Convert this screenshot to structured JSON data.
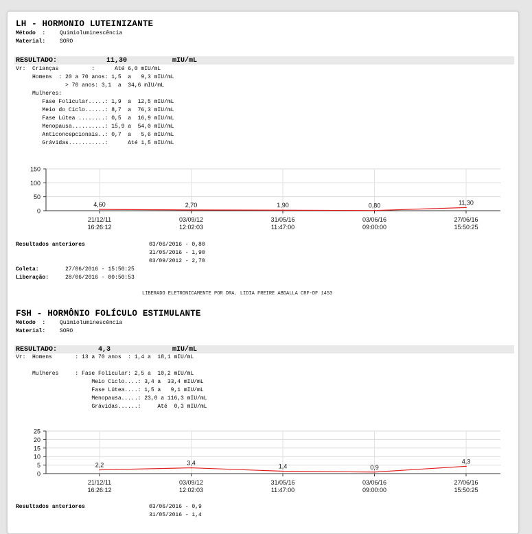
{
  "lh": {
    "title": "LH - HORMONIO LUTEINIZANTE",
    "metodo_label": "Método  :",
    "metodo": "Quimioluminescência",
    "material_label": "Material:",
    "material": "SORO",
    "resultado_label": "RESULTADO:",
    "resultado_value": "11,30",
    "resultado_unit": "mIU/mL",
    "ref_lines": [
      "Vr:  Crianças          :      Até 6,0 mIU/mL",
      "     Homens  : 20 a 70 anos: 1,5  a   9,3 mIU/mL",
      "               > 70 anos: 3,1  a  34,6 mIU/mL",
      "     Mulheres:",
      "        Fase Folicular.....: 1,9  a  12,5 mIU/mL",
      "        Meio do Ciclo......: 8,7  a  76,3 mIU/mL",
      "        Fase Lútea ........: 0,5  a  16,9 mIU/mL",
      "        Menopausa..........: 15,9 a  54,0 mIU/mL",
      "        Anticoncepcionais..: 0,7  a   5,6 mIU/mL",
      "        Grávidas...........:      Até 1,5 mIU/mL"
    ],
    "anteriores_label": "Resultados anteriores",
    "anteriores": [
      "03/06/2016 - 0,80",
      "31/05/2016 - 1,90",
      "03/09/2012 - 2,70"
    ],
    "coleta_label": "Coleta:",
    "coleta": "27/06/2016 - 15:50:25",
    "liberacao_label": "Liberação:",
    "liberacao": "28/06/2016 - 00:50:53",
    "liberado": "LIBERADO ELETRONICAMENTE POR DRA. LIDIA FREIRE ABDALLA CRF-DF 1453"
  },
  "fsh": {
    "title": "FSH - HORMÔNIO FOLÍCULO ESTIMULANTE",
    "metodo_label": "Método  :",
    "metodo": "Quimioluminescência",
    "material_label": "Material:",
    "material": "SORO",
    "resultado_label": "RESULTADO:",
    "resultado_value": "4,3",
    "resultado_unit": "mIU/mL",
    "ref_lines": [
      "Vr:  Homens       : 13 a 70 anos  : 1,4 a  18,1 mIU/mL",
      "",
      "",
      "     Mulheres     : Fase Folicular: 2,5 a  10,2 mIU/mL",
      "                       Meio Ciclo....: 3,4 a  33,4 mIU/mL",
      "                       Fase Lútea....: 1,5 a   9,1 mIU/mL",
      "                       Menopausa.....: 23,0 a 116,3 mIU/mL",
      "                       Grávidas......:     Até  0,3 mIU/mL"
    ],
    "anteriores_label": "Resultados anteriores",
    "anteriores": [
      "03/06/2016 - 0,9",
      "31/05/2016 - 1,4"
    ]
  },
  "chart_data": [
    {
      "type": "line",
      "x": [
        "21/12/11 16:26:12",
        "03/09/12 12:02:03",
        "31/05/16 11:47:00",
        "03/06/16 09:00:00",
        "27/06/16 15:50:25"
      ],
      "x_date": [
        "21/12/11",
        "03/09/12",
        "31/05/16",
        "03/06/16",
        "27/06/16"
      ],
      "x_time": [
        "16:26:12",
        "12:02:03",
        "11:47:00",
        "09:00:00",
        "15:50:25"
      ],
      "values": [
        4.6,
        2.7,
        1.9,
        0.8,
        11.3
      ],
      "value_labels": [
        "4,60",
        "2,70",
        "1,90",
        "0,80",
        "11,30"
      ],
      "yticks": [
        0,
        50,
        100,
        150
      ],
      "ylim": [
        0,
        150
      ],
      "grid": true,
      "line_color": "#e02020"
    },
    {
      "type": "line",
      "x": [
        "21/12/11 16:26:12",
        "03/09/12 12:02:03",
        "31/05/16 11:47:00",
        "03/06/16 09:00:00",
        "27/06/16 15:50:25"
      ],
      "x_date": [
        "21/12/11",
        "03/09/12",
        "31/05/16",
        "03/06/16",
        "27/06/16"
      ],
      "x_time": [
        "16:26:12",
        "12:02:03",
        "11:47:00",
        "09:00:00",
        "15:50:25"
      ],
      "values": [
        2.2,
        3.4,
        1.4,
        0.9,
        4.3
      ],
      "value_labels": [
        "2,2",
        "3,4",
        "1,4",
        "0,9",
        "4,3"
      ],
      "yticks": [
        0,
        5,
        10,
        15,
        20,
        25
      ],
      "ylim": [
        0,
        25
      ],
      "grid": true,
      "line_color": "#e02020"
    }
  ]
}
